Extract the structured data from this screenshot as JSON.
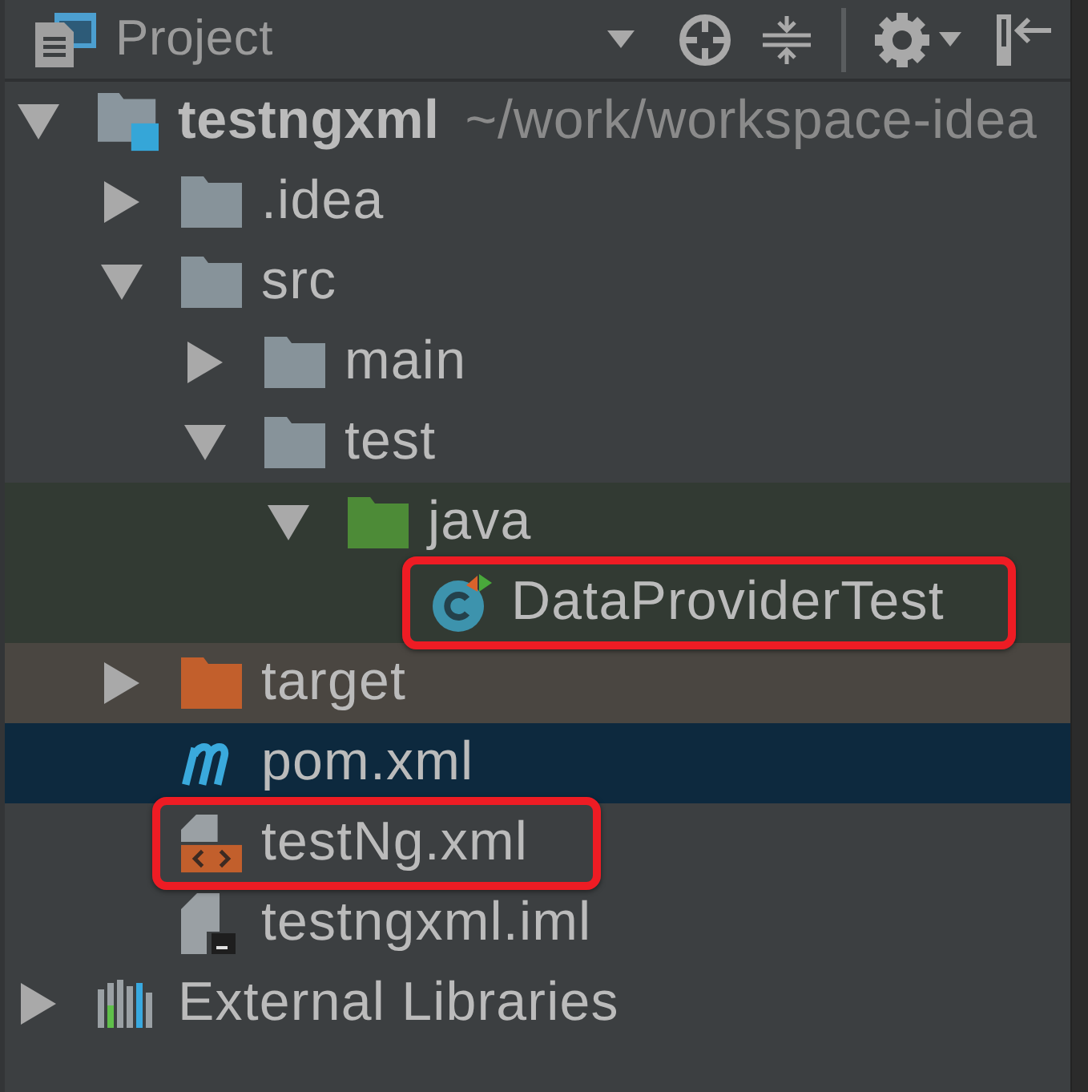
{
  "panel": {
    "title": "Project"
  },
  "tree": [
    {
      "kind": "module",
      "label": "testngxml",
      "path": "~/work/workspace-idea",
      "expanded": true,
      "selected": false,
      "annotated": false,
      "children": [
        {
          "kind": "folder",
          "label": ".idea",
          "expanded": false,
          "selected": false,
          "annotated": false
        },
        {
          "kind": "folder",
          "label": "src",
          "expanded": true,
          "selected": false,
          "annotated": false,
          "children": [
            {
              "kind": "folder",
              "label": "main",
              "expanded": false,
              "selected": false,
              "annotated": false
            },
            {
              "kind": "folder",
              "label": "test",
              "expanded": true,
              "selected": false,
              "annotated": false,
              "children": [
                {
                  "kind": "test-root",
                  "label": "java",
                  "expanded": true,
                  "selected": false,
                  "annotated": false,
                  "color": "#323a33",
                  "children": [
                    {
                      "kind": "class",
                      "label": "DataProviderTest",
                      "selected": false,
                      "annotated": true,
                      "color": "#323a33"
                    }
                  ]
                }
              ]
            }
          ]
        },
        {
          "kind": "excluded-folder",
          "label": "target",
          "expanded": false,
          "selected": false,
          "annotated": false,
          "color": "#4a4641"
        },
        {
          "kind": "maven",
          "label": "pom.xml",
          "selected": true,
          "annotated": false
        },
        {
          "kind": "xml",
          "label": "testNg.xml",
          "selected": false,
          "annotated": true
        },
        {
          "kind": "iml",
          "label": "testngxml.iml",
          "selected": false,
          "annotated": false
        }
      ]
    },
    {
      "kind": "libraries",
      "label": "External Libraries",
      "expanded": false,
      "selected": false,
      "annotated": false
    }
  ]
}
